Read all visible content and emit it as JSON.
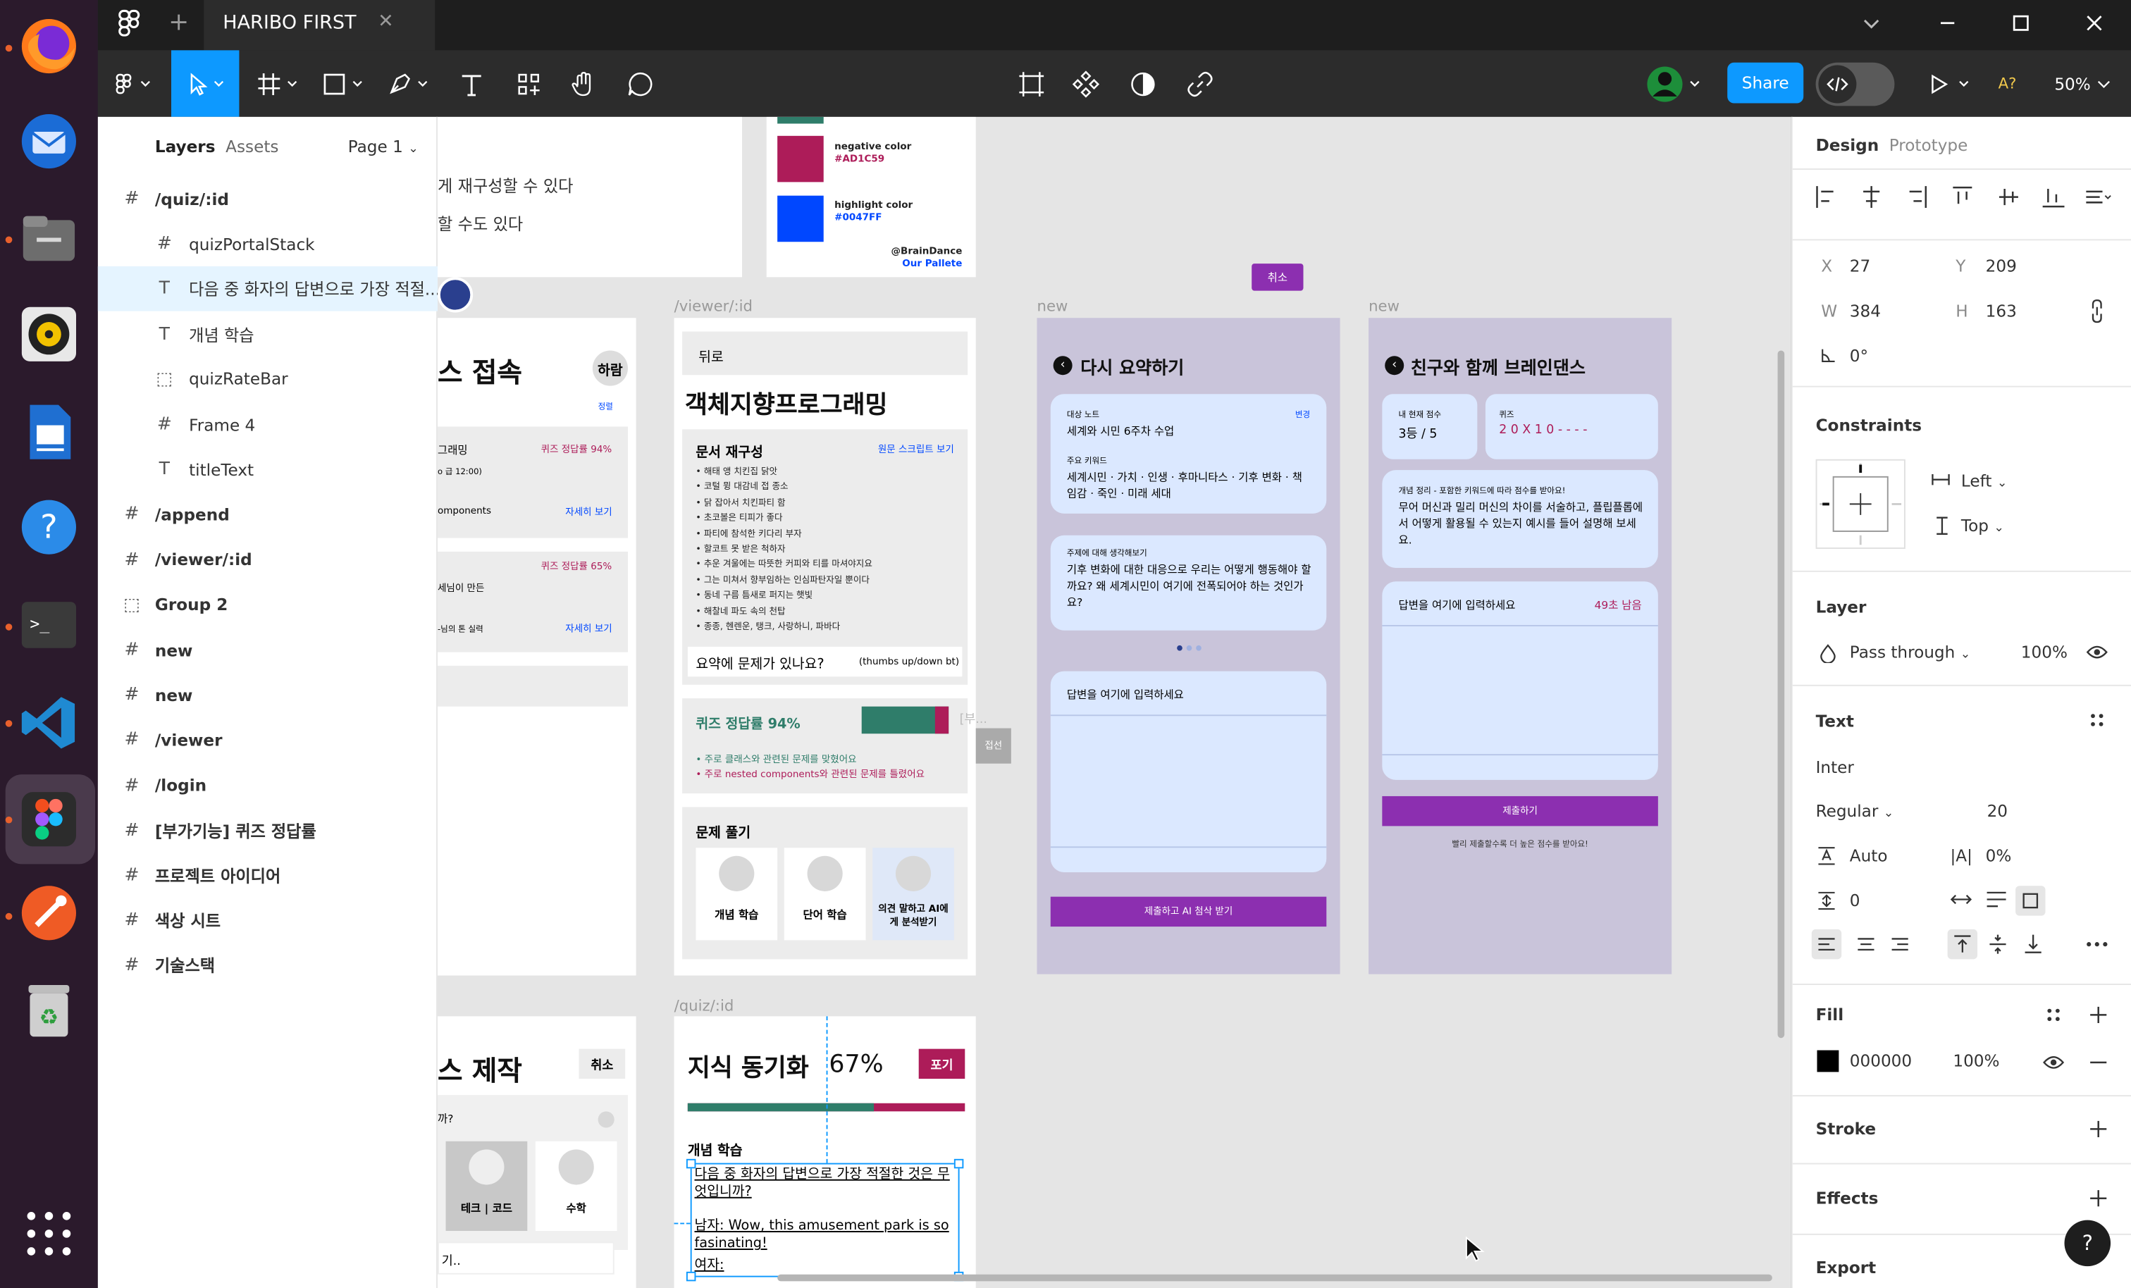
{
  "window": {
    "tab_title": "HARIBO FIRST",
    "zoom": "50%",
    "share": "Share",
    "font_badge": "A?"
  },
  "layers_panel": {
    "tab_layers": "Layers",
    "tab_assets": "Assets",
    "page": "Page 1",
    "items": [
      {
        "label": "/quiz/:id",
        "icon": "frame-icon"
      },
      {
        "label": "quizPortalStack",
        "icon": "frame-icon"
      },
      {
        "label": "다음 중 화자의 답변으로 가장 적절...",
        "icon": "text-icon"
      },
      {
        "label": "개념 학습",
        "icon": "text-icon"
      },
      {
        "label": "quizRateBar",
        "icon": "group-icon"
      },
      {
        "label": "Frame 4",
        "icon": "frame-icon"
      },
      {
        "label": "titleText",
        "icon": "text-icon"
      },
      {
        "label": "/append",
        "icon": "frame-icon"
      },
      {
        "label": "/viewer/:id",
        "icon": "frame-icon"
      },
      {
        "label": "Group 2",
        "icon": "group-icon"
      },
      {
        "label": "new",
        "icon": "frame-icon"
      },
      {
        "label": "new",
        "icon": "frame-icon"
      },
      {
        "label": "/viewer",
        "icon": "frame-icon"
      },
      {
        "label": "/login",
        "icon": "frame-icon"
      },
      {
        "label": "[부가기능] 퀴즈 정답률",
        "icon": "frame-icon"
      },
      {
        "label": "프로젝트 아이디어",
        "icon": "frame-icon"
      },
      {
        "label": "색상 시트",
        "icon": "frame-icon"
      },
      {
        "label": "기술스택",
        "icon": "frame-icon"
      }
    ]
  },
  "canvas": {
    "palette": {
      "negative_title": "negative color",
      "negative_hex": "#AD1C59",
      "highlight_title": "highlight color",
      "highlight_hex": "#0047FF",
      "credit1": "@BrainDance",
      "credit2": "Our Pallete",
      "neg_color": "#ad1c59",
      "hi_color": "#0047ff"
    },
    "partial_texts": {
      "t1": "게 재구성할 수 있다",
      "t2": "할 수도 있다"
    },
    "cancel_chip": "취소",
    "left_frame": {
      "title": "스 접속",
      "badge": "하람",
      "small": "정렬",
      "row1a": "그래밍",
      "row1b": "퀴즈 정답률 94%",
      "row1c": "o 급 12:00)",
      "row1d": "omponents",
      "row1e": "자세히 보기",
      "row2a": "퀴즈 정답률 65%",
      "row2b": "세님이 만든",
      "row2c": "-님의 톤 실력",
      "row2d": "자세히 보기"
    },
    "viewer": {
      "label": "/viewer/:id",
      "back": "뒤로",
      "title": "객체지향프로그래밍",
      "doc_head": "문서 재구성",
      "doc_link": "원문 스크립트 보기",
      "bullets": [
        "해태 앵 치킨집 닭앗",
        "코털 뮝 대감네 접 종소",
        "닭 잡아서 치킨파티 함",
        "초코볼은 티피가 좋다",
        "파티에 참석한 키다리 부자",
        "할코트 못 받은 척하자",
        "추운 겨울에는 따뜻한 커피와 티를 마셔야지요",
        "그는 미쳐서 향부임하는 인심파탄자일 뿐이다",
        "동네 구름 틈새로 퍼지는 햇빛",
        "해찰네 파도 속의 천탑",
        "종종, 헨렌운, 탱크, 사랑하니, 파바다"
      ],
      "summary_q": "요약에 문제가 있나요?",
      "thumbs": "(thumbs up/down bt)",
      "rate_title": "퀴즈 정답률 94%",
      "rate_side": "[부...",
      "rate_note1": "• 주로 클래스와 관련된 문제를 맞혔어요",
      "rate_note2": "• 주로 nested components와 관련된 문제를 틀렸어요",
      "ghost_btn": "접선",
      "solve_title": "문제 풀기",
      "card1": "개념 학습",
      "card2": "단어 학습",
      "card3": "의견 말하고 AI에게 분석받기"
    },
    "summary": {
      "label": "new",
      "title": "다시 요약하기",
      "target_label": "대상 노트",
      "change": "변경",
      "target_value": "세계와 시민 6주차 수업",
      "kw_label": "주요 키워드",
      "kw_value": "세계시민 · 가치 · 인생 · 후마니타스 · 기후 변화 · 책임감 · 죽인 · 미래 세대",
      "q_label": "주제에 대해 생각해보기",
      "q_value": "기후 변화에 대한 대응으로 우리는 어떻게 행동해야 할까요? 왜 세계시민이 여기에 전폭되어야 하는 것인가요?",
      "ans_ph": "답변을 여기에 입력하세요",
      "submit": "제출하고 AI 첨삭 받기"
    },
    "friend": {
      "label": "new",
      "title": "친구와 함께 브레인댄스",
      "score_label": "내 현재 점수",
      "score_value": "3등 / 5",
      "quiz_label": "퀴즈",
      "quiz_value": "2 0 X 1 0 - - - -",
      "prompt_label": "개념 정리 - 포함한 키워드에 따라 점수를 받아요!",
      "prompt_value": "무어 머신과 밀리 머신의 차이를 서술하고, 플립플롭에서 어떻게 활용될 수 있는지 예시를 들어 설명해 보세요.",
      "ans_ph": "답변을 여기에 입력하세요",
      "remain": "49초 남음",
      "submit": "제출하기",
      "note": "빨리 제출할수록 더 높은 점수를 받아요!"
    },
    "quiz": {
      "label": "/quiz/:id",
      "title": "지식 동기화",
      "pct": "67%",
      "giveup": "포기",
      "section": "개념 학습",
      "q1": "다음 중 화자의 답변으로 가장 적절한 것은 무엇입니까?",
      "q2": "남자: Wow, this amusement park is so fasinating!",
      "q3": "여자:"
    },
    "left_bottom": {
      "title": "스 제작",
      "cancel": "취소",
      "q": "까?",
      "card_a": "테크 | 코드",
      "card_b": "수학",
      "foot": "기.."
    }
  },
  "design_panel": {
    "tab_design": "Design",
    "tab_prototype": "Prototype",
    "x_label": "X",
    "x": "27",
    "y_label": "Y",
    "y": "209",
    "w_label": "W",
    "w": "384",
    "h_label": "H",
    "h": "163",
    "rot": "0°",
    "constraints": "Constraints",
    "c_h": "Left",
    "c_v": "Top",
    "layer": "Layer",
    "blend": "Pass through",
    "opacity": "100%",
    "text": "Text",
    "font": "Inter",
    "weight": "Regular",
    "size": "20",
    "line_height": "Auto",
    "letter": "0%",
    "para": "0",
    "fill": "Fill",
    "fill_hex": "000000",
    "fill_op": "100%",
    "fill_color": "#000000",
    "stroke": "Stroke",
    "effects": "Effects",
    "export": "Export",
    "help": "?"
  }
}
